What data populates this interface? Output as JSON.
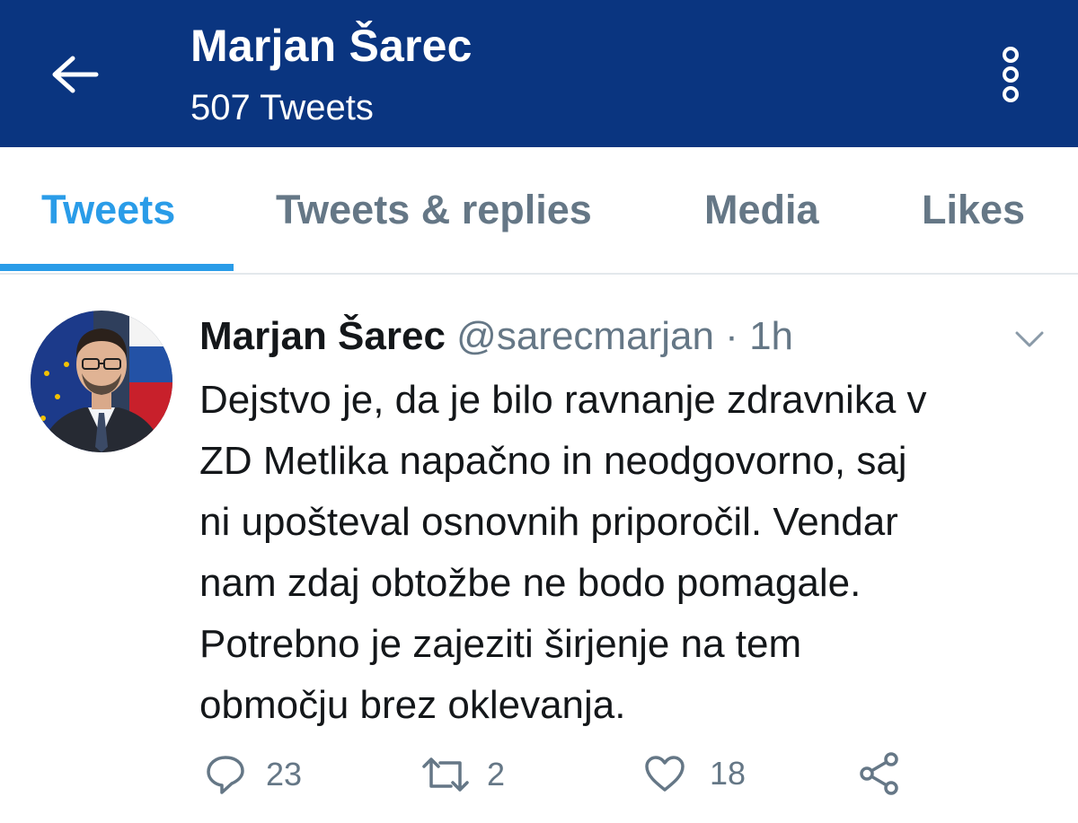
{
  "header": {
    "title": "Marjan Šarec",
    "subtitle": "507 Tweets",
    "back_icon": "arrow-left-icon",
    "more_icon": "vertical-dots-icon"
  },
  "tabs": [
    {
      "label": "Tweets",
      "active": true
    },
    {
      "label": "Tweets & replies",
      "active": false
    },
    {
      "label": "Media",
      "active": false
    },
    {
      "label": "Likes",
      "active": false
    }
  ],
  "tweet": {
    "author_name": "Marjan Šarec",
    "handle": "@sarecmarjan",
    "separator": "·",
    "time": "1h",
    "text_lines": [
      "Dejstvo je, da je bilo ravnanje zdravnika v",
      "ZD Metlika napačno in neodgovorno, saj",
      "ni upošteval osnovnih priporočil. Vendar",
      "nam zdaj obtožbe ne bodo pomagale.",
      "Potrebno je zajeziti širjenje na tem",
      "območju brez oklevanja."
    ],
    "actions": {
      "reply": {
        "icon": "reply-icon",
        "count": "23"
      },
      "retweet": {
        "icon": "retweet-icon",
        "count": "2"
      },
      "like": {
        "icon": "heart-icon",
        "count": "18"
      },
      "share": {
        "icon": "share-icon"
      }
    }
  },
  "colors": {
    "header_bg": "#0a3580",
    "accent": "#2a9ce8",
    "secondary_text": "#657786",
    "primary_text": "#14171a"
  }
}
